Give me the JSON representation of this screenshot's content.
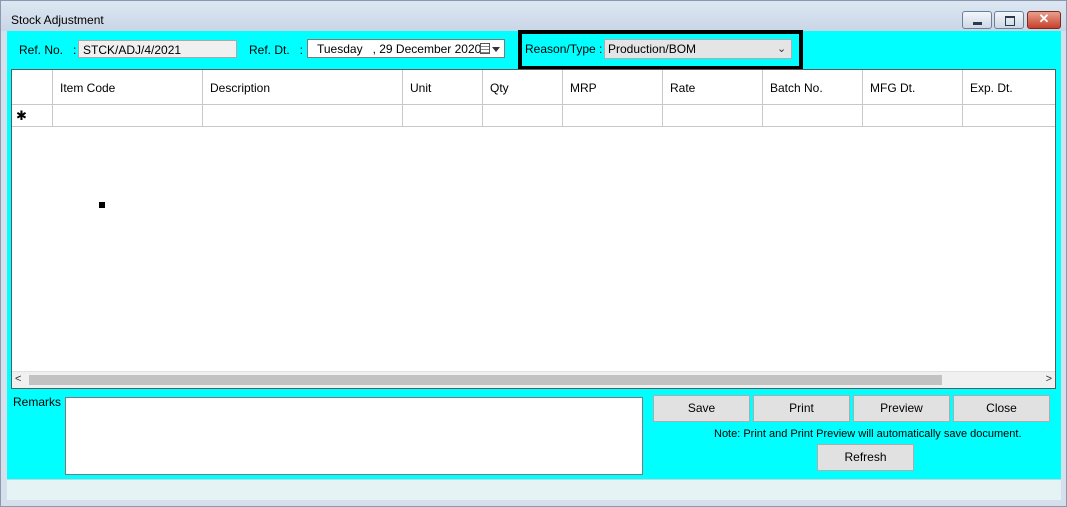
{
  "window": {
    "title": "Stock Adjustment",
    "min_glyph": "",
    "max_glyph": "",
    "close_glyph": "✕"
  },
  "form": {
    "ref_no_label": "Ref. No.   :",
    "ref_no_value": "STCK/ADJ/4/2021",
    "ref_dt_label": "Ref. Dt.   :",
    "ref_dt_value": "Tuesday   , 29 December 2020",
    "reason_label": "Reason/Type :",
    "reason_value": "Production/BOM",
    "reason_chevron": "⌄"
  },
  "grid": {
    "columns": [
      "Item Code",
      "Description",
      "Unit",
      "Qty",
      "MRP",
      "Rate",
      "Batch No.",
      "MFG Dt.",
      "Exp. Dt."
    ],
    "new_row_marker": "✱",
    "scroll_left": "<",
    "scroll_right": ">"
  },
  "remarks_label": "Remarks :",
  "buttons": {
    "save": "Save",
    "print": "Print",
    "preview": "Preview",
    "close": "Close",
    "refresh": "Refresh"
  },
  "note": "Note: Print and Print Preview will automatically save document.",
  "colors": {
    "client_bg": "#00ffff",
    "grid_bg": "#ffffff"
  }
}
